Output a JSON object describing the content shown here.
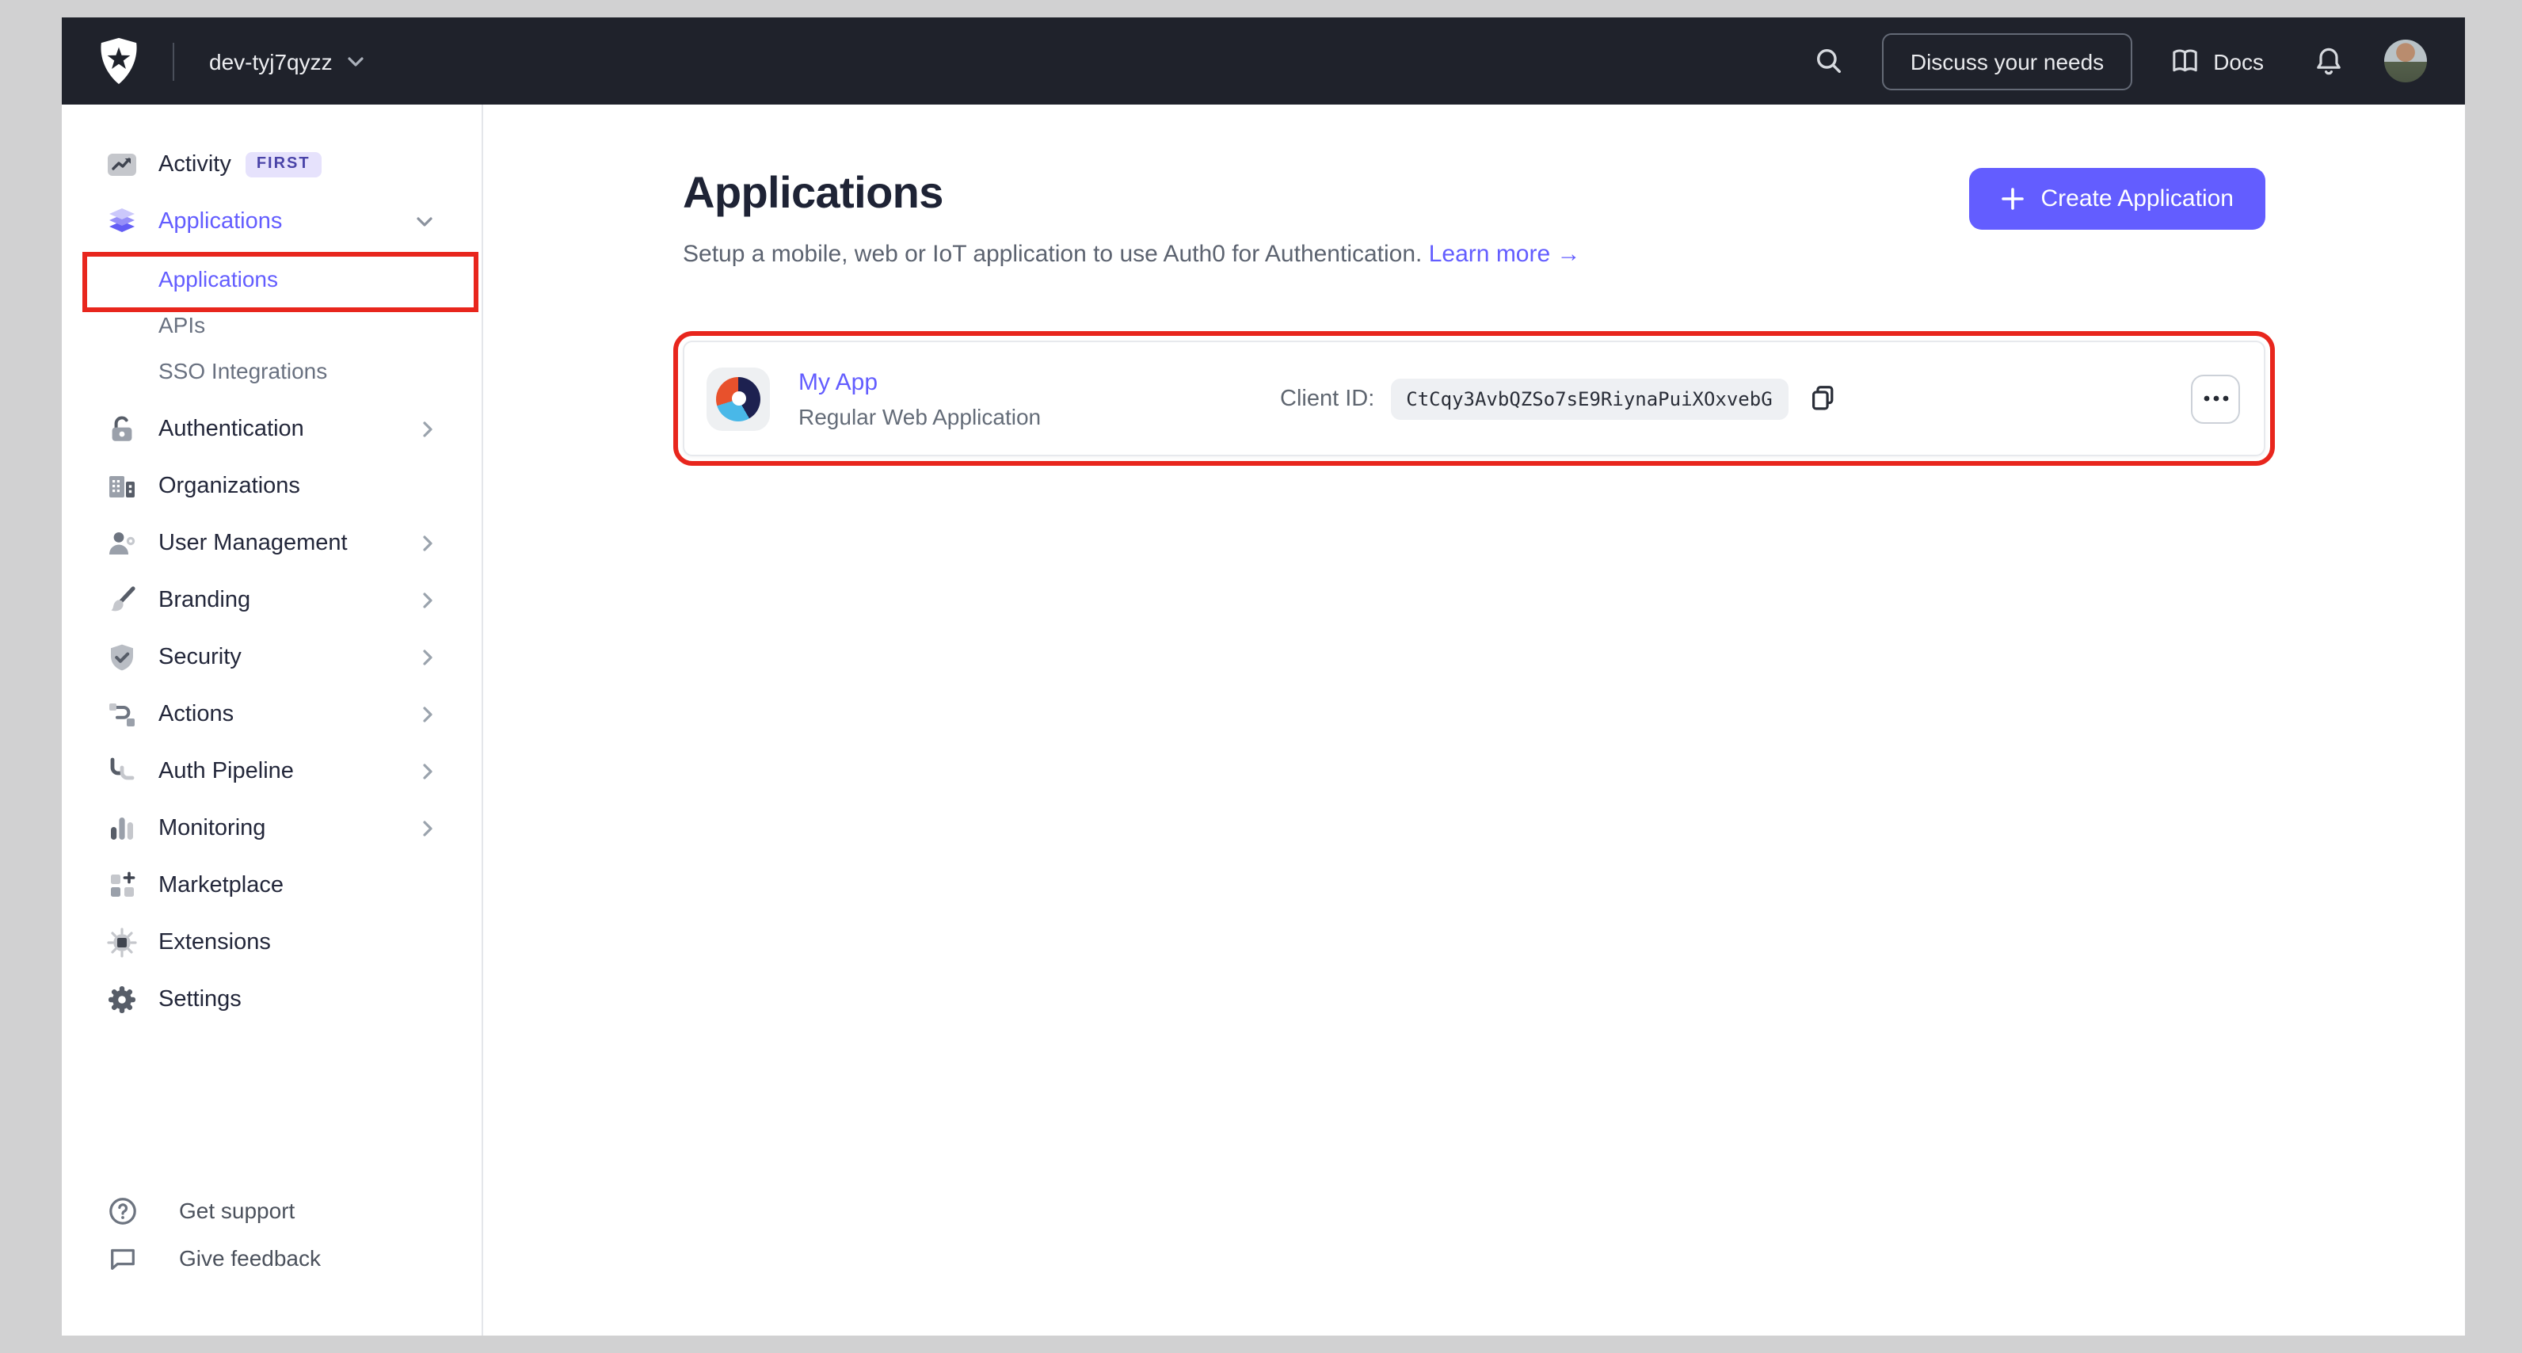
{
  "topbar": {
    "tenant": "dev-tyj7qyzz",
    "discuss_button": "Discuss your needs",
    "docs_label": "Docs"
  },
  "sidebar": {
    "items": [
      {
        "label": "Activity",
        "badge": "FIRST",
        "icon": "activity-icon"
      },
      {
        "label": "Applications",
        "icon": "applications-icon",
        "expanded": true,
        "active": true,
        "children": [
          {
            "label": "Applications",
            "active": true,
            "annotated": true
          },
          {
            "label": "APIs"
          },
          {
            "label": "SSO Integrations"
          }
        ]
      },
      {
        "label": "Authentication",
        "icon": "lock-icon",
        "chevron": true
      },
      {
        "label": "Organizations",
        "icon": "building-icon"
      },
      {
        "label": "User Management",
        "icon": "user-gear-icon",
        "chevron": true
      },
      {
        "label": "Branding",
        "icon": "paintbrush-icon",
        "chevron": true
      },
      {
        "label": "Security",
        "icon": "shield-check-icon",
        "chevron": true
      },
      {
        "label": "Actions",
        "icon": "actions-flow-icon",
        "chevron": true
      },
      {
        "label": "Auth Pipeline",
        "icon": "pipeline-icon",
        "chevron": true
      },
      {
        "label": "Monitoring",
        "icon": "bar-chart-icon",
        "chevron": true
      },
      {
        "label": "Marketplace",
        "icon": "marketplace-grid-icon"
      },
      {
        "label": "Extensions",
        "icon": "chip-icon"
      },
      {
        "label": "Settings",
        "icon": "gear-icon"
      }
    ],
    "footer_items": [
      {
        "label": "Get support",
        "icon": "help-circle-icon"
      },
      {
        "label": "Give feedback",
        "icon": "speech-bubble-icon"
      }
    ]
  },
  "main": {
    "title": "Applications",
    "subtitle": "Setup a mobile, web or IoT application to use Auth0 for Authentication.",
    "learn_more": "Learn more",
    "learn_more_arrow": "→",
    "create_button": "Create Application",
    "app_row": {
      "name": "My App",
      "type": "Regular Web Application",
      "client_id_label": "Client ID:",
      "client_id": "CtCqy3AvbQZSo7sE9RiynaPuiXOxvebG"
    }
  },
  "colors": {
    "accent": "#635DFF",
    "annotation": "#E8261D",
    "topbar_bg": "#1F222B",
    "app_logo_segments": [
      "#E8512C",
      "#1D2150",
      "#49B8E8"
    ]
  }
}
